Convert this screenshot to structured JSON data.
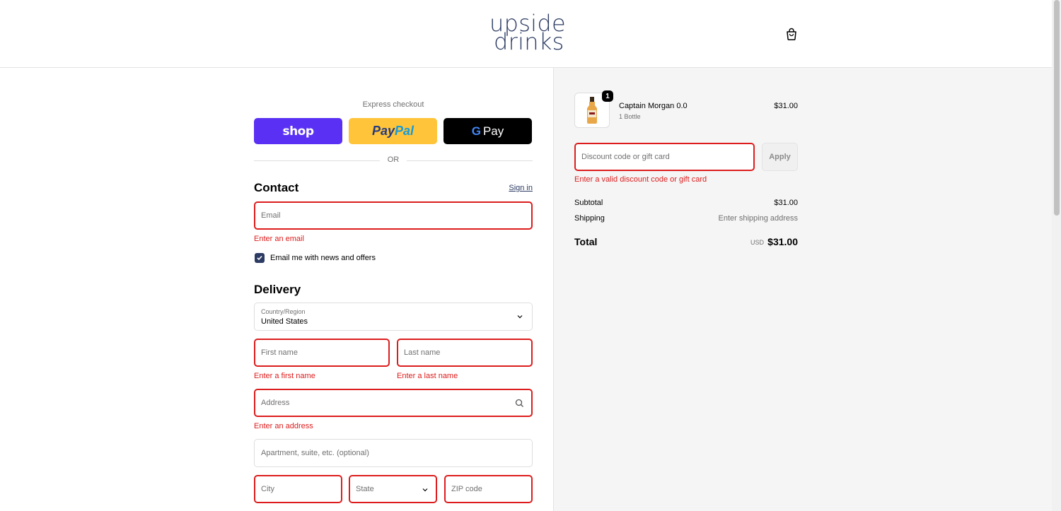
{
  "header": {
    "logo_line1": "upside",
    "logo_line2": "drinks",
    "cart_icon": "shopping-bag-icon"
  },
  "express": {
    "title": "Express checkout",
    "shop_label": "shop",
    "paypal_pay": "Pay",
    "paypal_pal": "Pal",
    "gpay_g": "G",
    "gpay_pay": "Pay",
    "or_label": "OR"
  },
  "contact": {
    "heading": "Contact",
    "sign_in": "Sign in",
    "email_placeholder": "Email",
    "email_error": "Enter an email",
    "newsletter_label": "Email me with news and offers",
    "newsletter_checked": true
  },
  "delivery": {
    "heading": "Delivery",
    "country_label": "Country/Region",
    "country_value": "United States",
    "first_name_placeholder": "First name",
    "first_name_error": "Enter a first name",
    "last_name_placeholder": "Last name",
    "last_name_error": "Enter a last name",
    "address_placeholder": "Address",
    "address_error": "Enter an address",
    "apartment_placeholder": "Apartment, suite, etc. (optional)",
    "city_placeholder": "City",
    "state_placeholder": "State",
    "zip_placeholder": "ZIP code"
  },
  "summary": {
    "item_name": "Captain Morgan 0.0",
    "item_variant": "1 Bottle",
    "item_price": "$31.00",
    "item_quantity": "1",
    "discount_placeholder": "Discount code or gift card",
    "apply_label": "Apply",
    "discount_error": "Enter a valid discount code or gift card",
    "subtotal_label": "Subtotal",
    "subtotal_value": "$31.00",
    "shipping_label": "Shipping",
    "shipping_value": "Enter shipping address",
    "total_label": "Total",
    "currency": "USD",
    "total_value": "$31.00"
  },
  "colors": {
    "brand": "#2c3b63",
    "error": "#dd1d1d",
    "shop_pay": "#5a31f4",
    "paypal": "#ffc439"
  }
}
